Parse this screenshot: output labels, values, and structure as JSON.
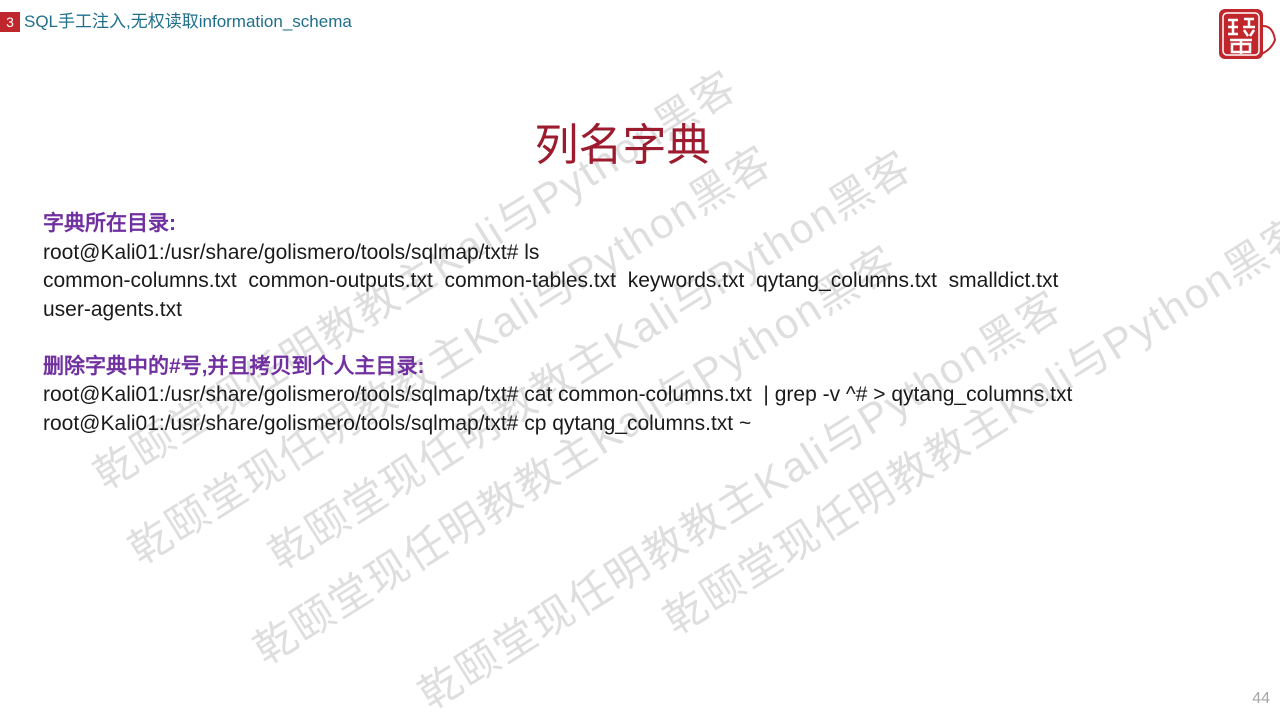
{
  "header": {
    "section_number": "3",
    "section_title": "SQL手工注入,无权读取information_schema"
  },
  "logo": {
    "icon": "seal-stamp-icon",
    "text": "乾颐堂"
  },
  "watermark": {
    "line1": "乾颐堂现任明教教主Kali与Python黑客",
    "line2": "乾颐堂现任明教教主Kali与Python黑客",
    "line3": "乾颐堂现任明教教主Kali与Python黑客",
    "line4": "乾颐堂现任明教教主Kali与Python黑客",
    "line5": "乾颐堂现任明教教主Kali与Python黑客",
    "line6": "乾颐堂现任明教教主Kali与Python黑客"
  },
  "title": "列名字典",
  "content": {
    "label_dir": "字典所在目录:",
    "cmd_ls": "root@Kali01:/usr/share/golismero/tools/sqlmap/txt# ls",
    "ls_output_1": "common-columns.txt  common-outputs.txt  common-tables.txt  keywords.txt  qytang_columns.txt  smalldict.txt",
    "ls_output_2": "user-agents.txt",
    "label_delete": "删除字典中的#号,并且拷贝到个人主目录:",
    "cmd_grep": "root@Kali01:/usr/share/golismero/tools/sqlmap/txt# cat common-columns.txt  | grep -v ^# > qytang_columns.txt",
    "cmd_cp": "root@Kali01:/usr/share/golismero/tools/sqlmap/txt# cp qytang_columns.txt ~"
  },
  "page_number": "44",
  "colors": {
    "accent_red": "#c0272d",
    "header_text": "#1f6f8b",
    "title": "#9c1b2f",
    "label_purple": "#7030a0"
  }
}
